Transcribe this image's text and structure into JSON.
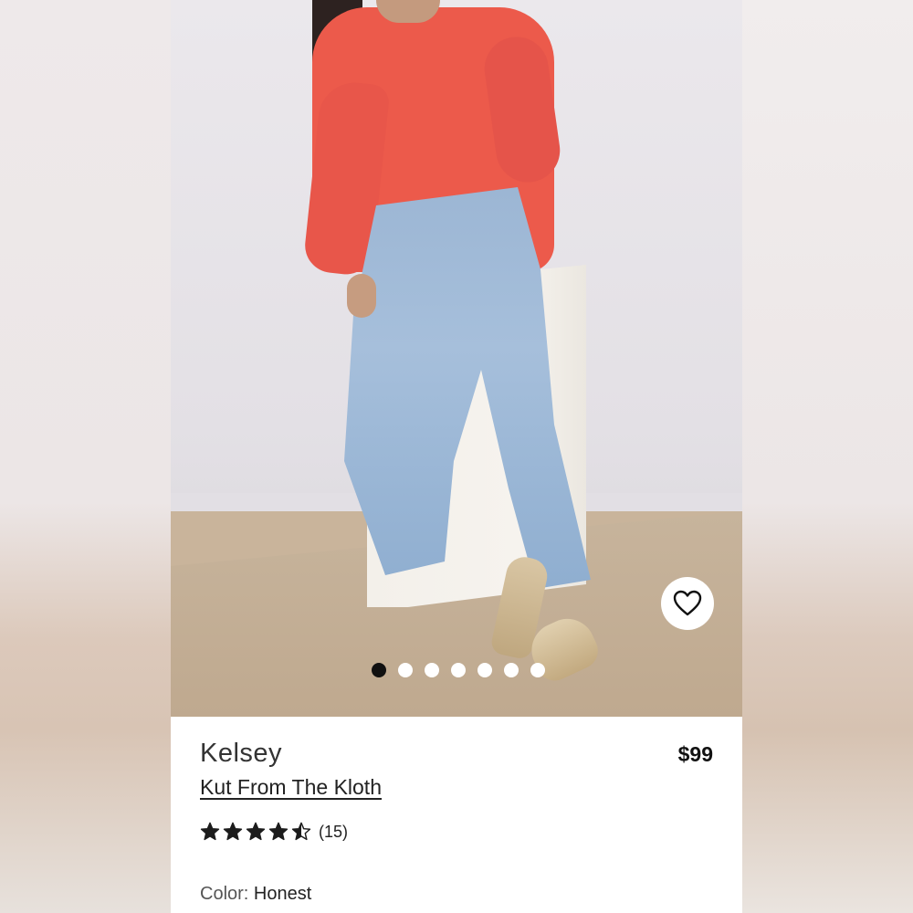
{
  "product": {
    "style_name": "Kelsey",
    "brand": "Kut From The Kloth",
    "price": "$99",
    "rating": 4.5,
    "rating_max": 5,
    "review_count": "(15)",
    "color_label": "Color:",
    "color_value": "Honest"
  },
  "gallery": {
    "total_images": 7,
    "active_index": 0
  },
  "icons": {
    "favorite": "heart-outline-icon",
    "star_full": "star-filled-icon",
    "star_half": "star-half-icon"
  },
  "colors": {
    "text_primary": "#222222",
    "dot_active": "#111111",
    "dot_inactive": "#ffffff",
    "star": "#1c1c1c"
  }
}
